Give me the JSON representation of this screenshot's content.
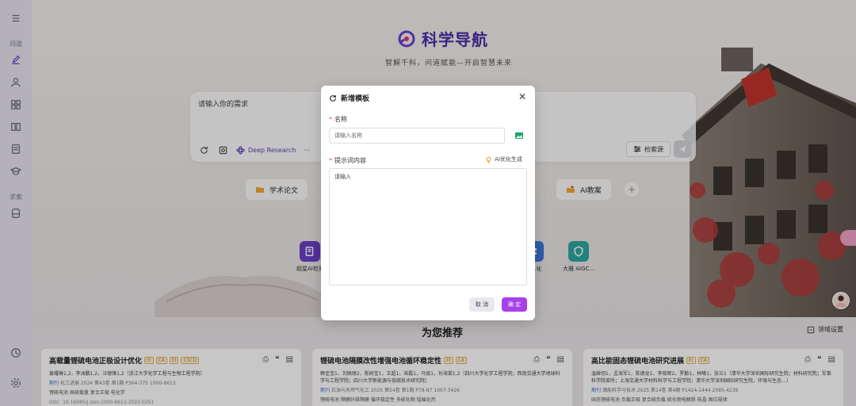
{
  "sidebar": {
    "section_qa": "问道",
    "section_explore": "求索",
    "icons": [
      "menu-icon",
      "edit-icon",
      "user-icon",
      "apps-icon",
      "book-icon",
      "document-icon",
      "graduation-icon",
      "database-icon",
      "history-icon",
      "settings-icon"
    ]
  },
  "hero": {
    "title": "科学导航",
    "subtitle": "智解千科，问道赋能—开启智慧未来"
  },
  "query": {
    "placeholder": "请输入你的需求",
    "deep_research": "Deep Research",
    "more": "···",
    "source_button": "检索源"
  },
  "chips": [
    {
      "label": "学术论文",
      "icon": "folder-icon"
    },
    {
      "label": "AI教案",
      "icon": "ai-icon"
    }
  ],
  "apps": [
    {
      "label": "超星AI检索",
      "color": "#6b3fc7"
    },
    {
      "label": "……化",
      "color": "#3c76d8"
    },
    {
      "label": "大雅 AIGC…",
      "color": "#2fa7a0"
    }
  ],
  "recommend": {
    "title": "为您推荐",
    "domain_settings": "领域设置",
    "cards": [
      {
        "title": "高载量锂硫电池正极设计优化",
        "tags": [
          "EI",
          "CA",
          "EI",
          "CSCD"
        ],
        "authors": "姜耀琳1,2，李洲鹏1,2，汪德锋1,2（浙江大学化学工程与生物工程学院）",
        "journal_type": "期刊",
        "journal": "化工进展 2024 第43卷 第1期 P364-375 1000-6613",
        "keywords": "锂硫电池   高硫载量   复合正极   电化学",
        "doi": "DOI：10.16085/j.issn.1000-6613.2023-0251"
      },
      {
        "title": "锂硫电池隔膜改性增强电池循环稳定性",
        "tags": [
          "EI",
          "CA"
        ],
        "authors": "赖佳宝1，刘佩丽2，陈树宝1，王超1，宋磊1，马骁1，孙海棠1,2（四川大学化学工程学院；西南交通大学地球科学与工程学院；四川大学新能源与低碳技术研究院）",
        "journal_type": "期刊",
        "journal": "石油与天然气化工 2025 第54卷 第1期 P78-87 1007-3426",
        "keywords": "锂硫电池   隔膜纤维隔膜   循环稳定性   多硫化物   锰催化剂",
        "doi": ""
      },
      {
        "title": "高比能固态锂硫电池研究进展",
        "tags": [
          "EI",
          "CA"
        ],
        "authors": "温婵羽1，孟海军1，陈德龙1，李晓辉2，罗勤1，林曦1，张兰1（清华大学深圳国际研究生院；材料研究院；军事科学院某所；上海交通大学材料科学与工程学院；清华大学深圳国际研究生院，环境与生态…）",
        "journal_type": "期刊",
        "journal": "储能科学与技术 2025 第14卷 第4期 P1424-1444 2095-4239",
        "keywords": "固态锂硫电池   负载正极   复合硫负载   硫化物电解质   枝晶   固位规律",
        "doi": ""
      }
    ]
  },
  "modal": {
    "title": "新增模板",
    "name_label": "名称",
    "name_placeholder": "请输入名称",
    "prompt_label": "提示词内容",
    "ai_optimize": "AI优化生成",
    "prompt_placeholder": "请输入",
    "cancel": "取 消",
    "confirm": "确 定",
    "required_mark": "*"
  },
  "colors": {
    "brand": "#4a2ea6",
    "primary_button": "#a640ea",
    "required": "#e5484d"
  }
}
